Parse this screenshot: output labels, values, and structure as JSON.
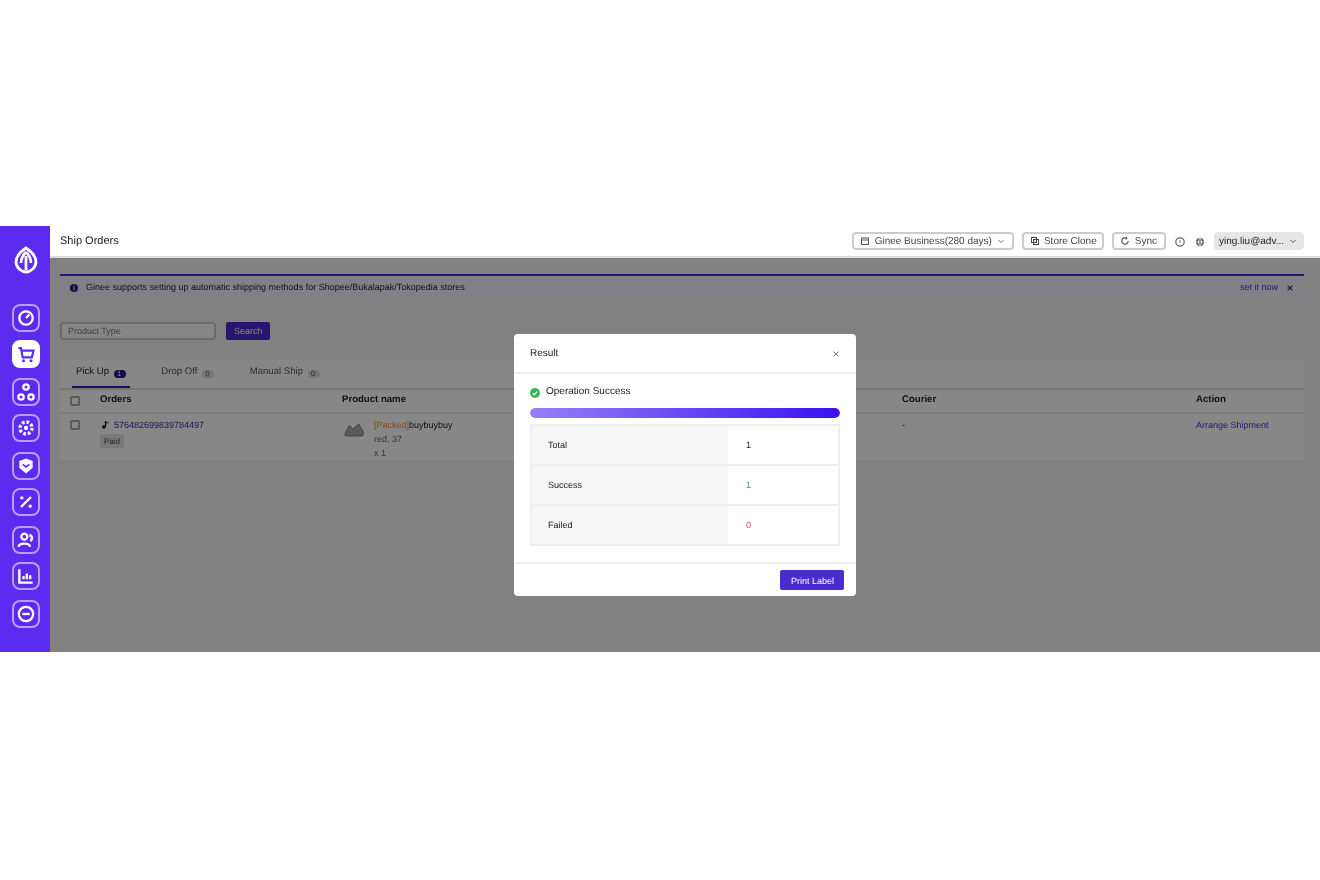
{
  "sidebar": {
    "items": [
      {
        "kind": "gauge",
        "selected": false
      },
      {
        "kind": "cart",
        "selected": true
      },
      {
        "kind": "network",
        "selected": false
      },
      {
        "kind": "gear",
        "selected": false
      },
      {
        "kind": "box",
        "selected": false
      },
      {
        "kind": "percent",
        "selected": false
      },
      {
        "kind": "people",
        "selected": false
      },
      {
        "kind": "chart",
        "selected": false
      },
      {
        "kind": "minus",
        "selected": false
      }
    ]
  },
  "header": {
    "title": "Ship Orders",
    "store": "Ginee Business(280 days)",
    "buttons": [
      {
        "kind": "clone",
        "label": "Store Clone"
      },
      {
        "kind": "sync",
        "label": "Sync"
      }
    ],
    "user": "ying.liu@adv..."
  },
  "notice": {
    "text": "Ginee supports setting up automatic shipping methods for Shopee/Bukalapak/Tokopedia stores",
    "link": "set it now"
  },
  "filter": {
    "placeholder": "Product Type",
    "button": "Search"
  },
  "tabs": [
    {
      "label": "Pick Up",
      "count": "1",
      "selected": true
    },
    {
      "label": "Drop Off",
      "count": "0",
      "selected": false
    },
    {
      "label": "Manual Ship",
      "count": "0",
      "selected": false
    }
  ],
  "table": {
    "all_checked": false,
    "columns": [
      "Orders",
      "Product name",
      "Courier",
      "Action"
    ],
    "rows": [
      {
        "checked": false,
        "order": "576482699839784497",
        "badge": "Paid",
        "product_tag": "[Packed]",
        "product": "buybuybuy",
        "variant": "red, 37",
        "quantity": "x 1",
        "courier": "-",
        "action": "Arrange Shipment"
      }
    ]
  },
  "dialog": {
    "title": "Result",
    "status": "Operation Success",
    "level": 1,
    "rows": [
      {
        "kind": "total",
        "label": "Total",
        "value": "1"
      },
      {
        "kind": "success",
        "label": "Success",
        "value": "1"
      },
      {
        "kind": "failed",
        "label": "Failed",
        "value": "0"
      }
    ],
    "button": "Print Label"
  }
}
